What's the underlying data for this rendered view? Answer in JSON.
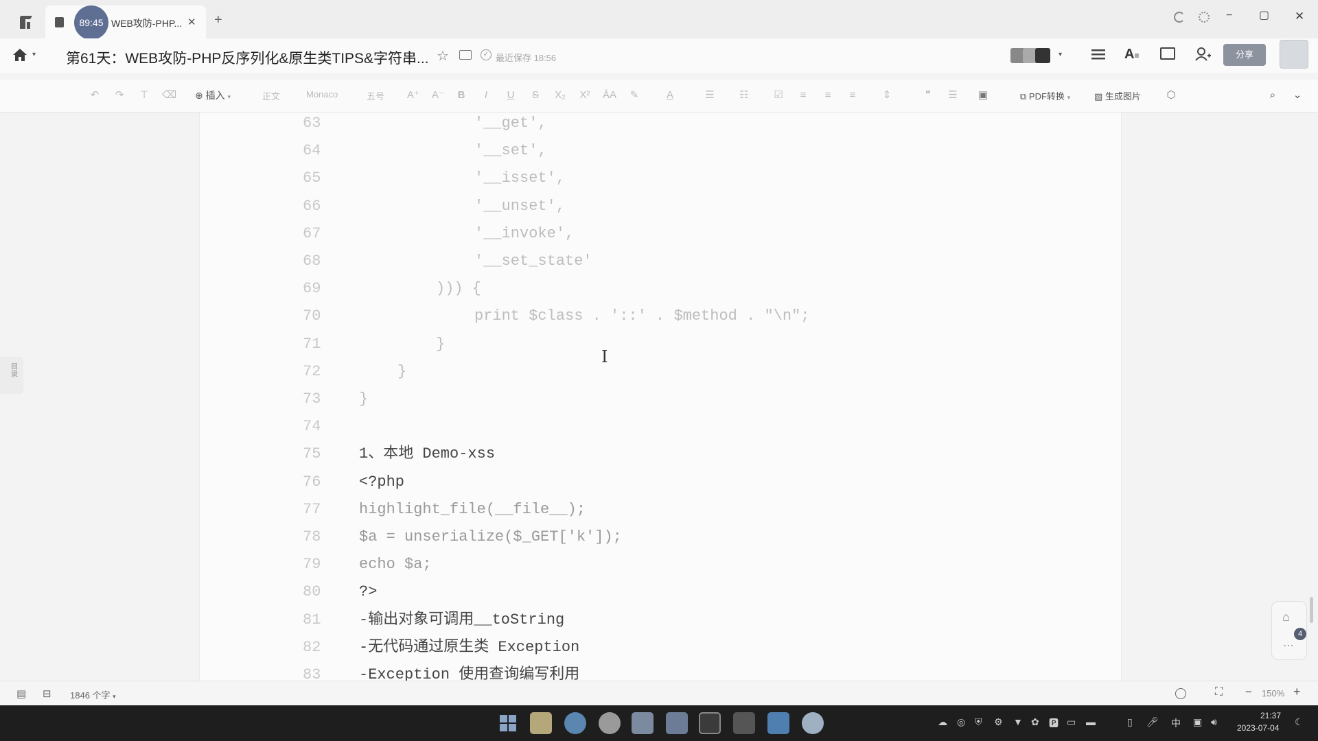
{
  "tab": {
    "timer": "89:45",
    "title": "WEB攻防-PHP...",
    "close": "✕",
    "new": "+"
  },
  "window_controls": {
    "minimize": "−",
    "maximize": "▢",
    "close": "✕"
  },
  "doc_title": "第61天：WEB攻防-PHP反序列化&原生类TIPS&字符串...",
  "save_status": "最近保存 18:56",
  "share_label": "分享",
  "toolbar": {
    "insert": "插入",
    "style": "正文",
    "font": "Monaco",
    "size": "五号",
    "pdf": "PDF转换",
    "gen_image": "生成图片"
  },
  "sidebar_toc": "目录",
  "code_lines": [
    {
      "n": "63",
      "text": "'__get',",
      "indent": 3,
      "style": "code"
    },
    {
      "n": "64",
      "text": "'__set',",
      "indent": 3,
      "style": "code"
    },
    {
      "n": "65",
      "text": "'__isset',",
      "indent": 3,
      "style": "code"
    },
    {
      "n": "66",
      "text": "'__unset',",
      "indent": 3,
      "style": "code"
    },
    {
      "n": "67",
      "text": "'__invoke',",
      "indent": 3,
      "style": "code"
    },
    {
      "n": "68",
      "text": "'__set_state'",
      "indent": 3,
      "style": "code"
    },
    {
      "n": "69",
      "text": "))) {",
      "indent": 2,
      "style": "code"
    },
    {
      "n": "70",
      "text": "print $class . '::' . $method . \"\\n\";",
      "indent": 3,
      "style": "code"
    },
    {
      "n": "71",
      "text": "}",
      "indent": 2,
      "style": "code"
    },
    {
      "n": "72",
      "text": "}",
      "indent": 1,
      "style": "code"
    },
    {
      "n": "73",
      "text": "}",
      "indent": 0,
      "style": "code"
    },
    {
      "n": "74",
      "text": "",
      "indent": 0,
      "style": "code"
    },
    {
      "n": "75",
      "text": "1、本地 Demo-xss",
      "indent": 0,
      "style": "doc"
    },
    {
      "n": "76",
      "text": "<?php",
      "indent": 0,
      "style": "doc"
    },
    {
      "n": "77",
      "text": "highlight_file(__file__);",
      "indent": 0,
      "style": "mid"
    },
    {
      "n": "78",
      "text": "$a = unserialize($_GET['k']);",
      "indent": 0,
      "style": "mid"
    },
    {
      "n": "79",
      "text": "echo $a;",
      "indent": 0,
      "style": "mid"
    },
    {
      "n": "80",
      "text": "?>",
      "indent": 0,
      "style": "doc"
    },
    {
      "n": "81",
      "text": "-输出对象可调用__toString",
      "indent": 0,
      "style": "doc"
    },
    {
      "n": "82",
      "text": "-无代码通过原生类 Exception",
      "indent": 0,
      "style": "doc"
    },
    {
      "n": "83",
      "text": "-Exception 使用查询编写利用",
      "indent": 0,
      "style": "doc"
    }
  ],
  "status": {
    "word_count": "1846 个字",
    "zoom": "150%"
  },
  "floating_badge": "4",
  "clock": {
    "time": "21:37",
    "date": "2023-07-04"
  },
  "tray_lang": "中"
}
